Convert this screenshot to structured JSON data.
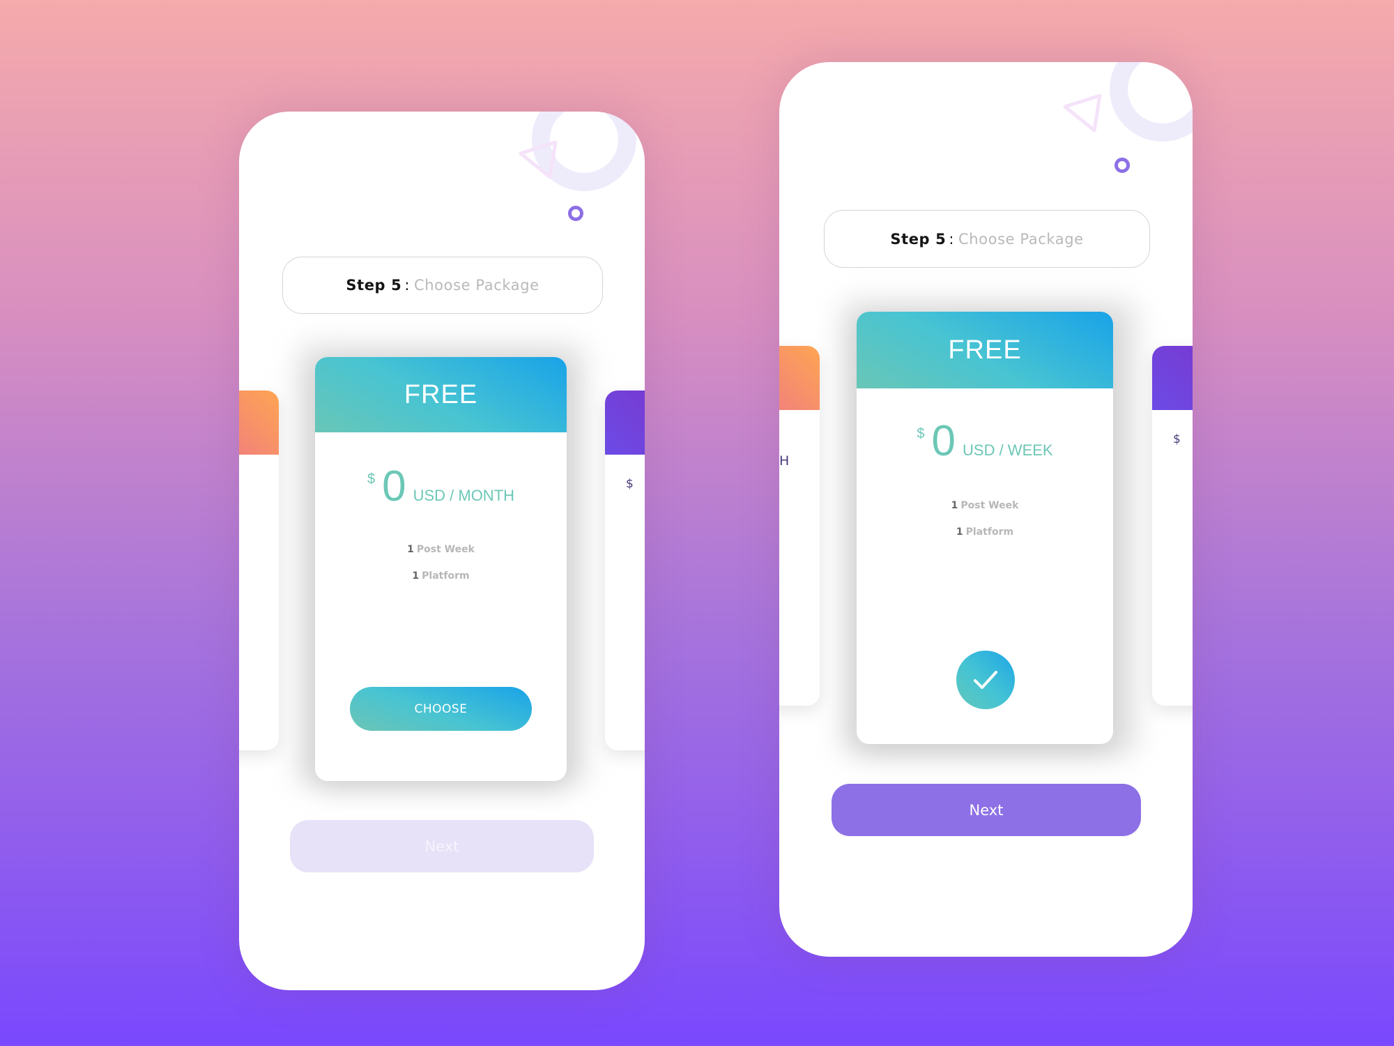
{
  "colors": {
    "accent_teal": "#6cc7b6",
    "accent_blue": "#19a3e8",
    "primary_purple": "#8d70e6",
    "disabled_lavender": "#e7e2f8",
    "side_orange": "#fea553",
    "side_pink": "#ef7a83",
    "side_purple": "#6c4be6"
  },
  "screens": [
    {
      "step": {
        "label": "Step 5",
        "separator": ":",
        "title": "Choose Package"
      },
      "plan": {
        "name": "FREE",
        "currency": "$",
        "amount": "0",
        "period": "USD / MONTH",
        "features": [
          {
            "count": "1",
            "label": "Post Week"
          },
          {
            "count": "1",
            "label": "Platform"
          }
        ],
        "action_label": "CHOOSE",
        "selected": false
      },
      "side_cards": {
        "left": {
          "partial_text": ""
        },
        "right": {
          "partial_text": "$"
        }
      },
      "next": {
        "label": "Next",
        "enabled": false
      },
      "icons": {
        "decor": [
          "ring-decoration",
          "triangle-decoration",
          "dot-decoration"
        ]
      }
    },
    {
      "step": {
        "label": "Step 5",
        "separator": ":",
        "title": "Choose Package"
      },
      "plan": {
        "name": "FREE",
        "currency": "$",
        "amount": "0",
        "period": "USD / WEEK",
        "features": [
          {
            "count": "1",
            "label": "Post Week"
          },
          {
            "count": "1",
            "label": "Platform"
          }
        ],
        "action_icon": "checkmark-icon",
        "selected": true
      },
      "side_cards": {
        "left": {
          "partial_text": "H"
        },
        "right": {
          "partial_text": "$"
        }
      },
      "next": {
        "label": "Next",
        "enabled": true
      },
      "icons": {
        "decor": [
          "ring-decoration",
          "triangle-decoration",
          "dot-decoration"
        ]
      }
    }
  ]
}
